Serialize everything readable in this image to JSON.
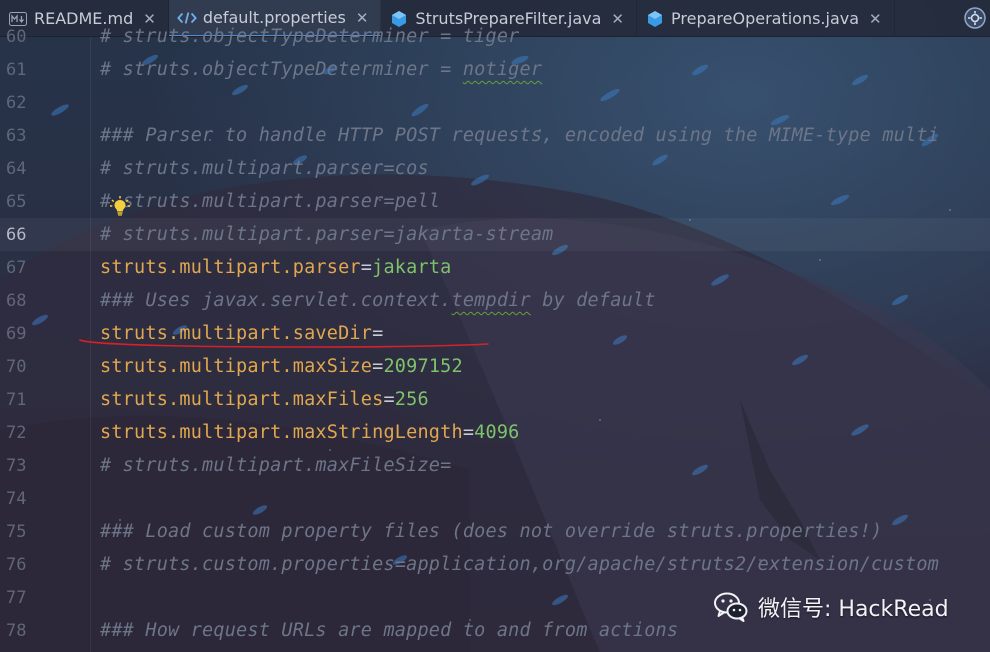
{
  "tabs": [
    {
      "label": "README.md",
      "icon": "markdown-icon",
      "active": false
    },
    {
      "label": "default.properties",
      "icon": "code-icon",
      "active": true
    },
    {
      "label": "StrutsPrepareFilter.java",
      "icon": "java-class-icon",
      "active": false
    },
    {
      "label": "PrepareOperations.java",
      "icon": "java-class-icon",
      "active": false
    }
  ],
  "tab_close_glyph": "✕",
  "lines": [
    {
      "num": "60",
      "parts": [
        {
          "t": "cmt",
          "s": "# struts.objectTypeDeterminer = tiger"
        }
      ]
    },
    {
      "num": "61",
      "parts": [
        {
          "t": "cmt",
          "s": "# struts.objectTypeDeterminer = "
        },
        {
          "t": "cmt-wavy",
          "s": "notiger"
        }
      ]
    },
    {
      "num": "62",
      "parts": []
    },
    {
      "num": "63",
      "parts": [
        {
          "t": "cmt",
          "s": "### Parser to handle HTTP POST requests, encoded using the MIME-type multi"
        }
      ]
    },
    {
      "num": "64",
      "parts": [
        {
          "t": "cmt",
          "s": "# struts.multipart.parser=cos"
        }
      ]
    },
    {
      "num": "65",
      "parts": [
        {
          "t": "cmt",
          "s": "# struts.multipart.parser=pell"
        }
      ]
    },
    {
      "num": "66",
      "current": true,
      "parts": [
        {
          "t": "cmt",
          "s": "# struts.multipart.parser=jakarta-stream"
        }
      ]
    },
    {
      "num": "67",
      "parts": [
        {
          "t": "key",
          "s": "struts.multipart.parser"
        },
        {
          "t": "eq",
          "s": "="
        },
        {
          "t": "val",
          "s": "jakarta"
        }
      ]
    },
    {
      "num": "68",
      "parts": [
        {
          "t": "cmt",
          "s": "### Uses javax.servlet.context."
        },
        {
          "t": "cmt-wavy",
          "s": "tempdir"
        },
        {
          "t": "cmt",
          "s": " by default"
        }
      ]
    },
    {
      "num": "69",
      "parts": [
        {
          "t": "key",
          "s": "struts.multipart.saveDir"
        },
        {
          "t": "eq",
          "s": "="
        }
      ]
    },
    {
      "num": "70",
      "parts": [
        {
          "t": "key",
          "s": "struts.multipart.maxSize"
        },
        {
          "t": "eq",
          "s": "="
        },
        {
          "t": "val",
          "s": "2097152"
        }
      ]
    },
    {
      "num": "71",
      "parts": [
        {
          "t": "key",
          "s": "struts.multipart.maxFiles"
        },
        {
          "t": "eq",
          "s": "="
        },
        {
          "t": "val",
          "s": "256"
        }
      ]
    },
    {
      "num": "72",
      "parts": [
        {
          "t": "key",
          "s": "struts.multipart.maxStringLength"
        },
        {
          "t": "eq",
          "s": "="
        },
        {
          "t": "val",
          "s": "4096"
        }
      ]
    },
    {
      "num": "73",
      "parts": [
        {
          "t": "cmt",
          "s": "# struts.multipart.maxFileSize="
        }
      ]
    },
    {
      "num": "74",
      "parts": []
    },
    {
      "num": "75",
      "parts": [
        {
          "t": "cmt",
          "s": "### Load custom property files (does not override struts.properties!)"
        }
      ]
    },
    {
      "num": "76",
      "parts": [
        {
          "t": "cmt",
          "s": "# struts.custom.properties=application,org/apache/struts2/extension/custom"
        }
      ]
    },
    {
      "num": "77",
      "parts": []
    },
    {
      "num": "78",
      "parts": [
        {
          "t": "cmt",
          "s": "### How request URLs are mapped to and from actions"
        }
      ]
    }
  ],
  "watermark": {
    "text": "微信号: HackRead",
    "icon": "wechat-icon"
  },
  "colors": {
    "comment": "#6d7588",
    "key": "#e0a74f",
    "value": "#7ec26b",
    "underline_red": "#d8202a",
    "tab_accent": "#4a8fd6"
  }
}
